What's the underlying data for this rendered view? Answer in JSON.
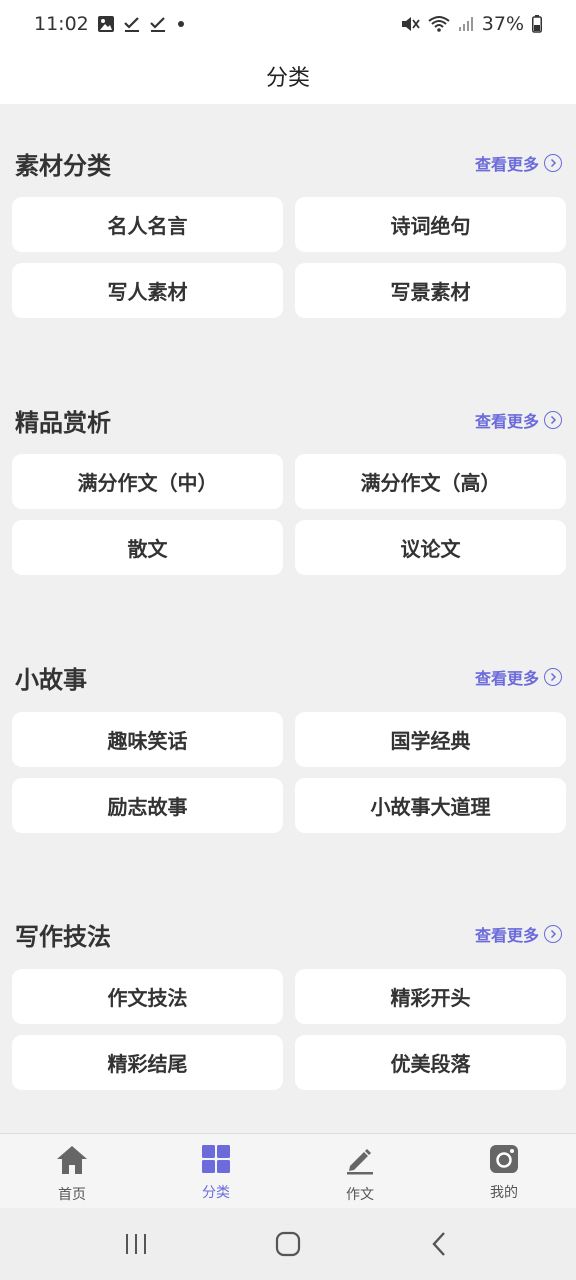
{
  "status_bar": {
    "time": "11:02",
    "battery": "37%",
    "left_icons": [
      "image-icon",
      "check-icon",
      "check-icon",
      "dot-icon"
    ],
    "right_icons": [
      "mute-icon",
      "wifi-icon",
      "signal-icon",
      "battery-icon"
    ]
  },
  "header": {
    "title": "分类"
  },
  "more_label": "查看更多",
  "sections": [
    {
      "title": "素材分类",
      "items": [
        "名人名言",
        "诗词绝句",
        "写人素材",
        "写景素材"
      ]
    },
    {
      "title": "精品赏析",
      "items": [
        "满分作文（中）",
        "满分作文（高）",
        "散文",
        "议论文"
      ]
    },
    {
      "title": "小故事",
      "items": [
        "趣味笑话",
        "国学经典",
        "励志故事",
        "小故事大道理"
      ]
    },
    {
      "title": "写作技法",
      "items": [
        "作文技法",
        "精彩开头",
        "精彩结尾",
        "优美段落"
      ]
    }
  ],
  "tabs": [
    {
      "label": "首页",
      "icon": "home-icon",
      "active": false
    },
    {
      "label": "分类",
      "icon": "grid-icon",
      "active": true
    },
    {
      "label": "作文",
      "icon": "pen-icon",
      "active": false
    },
    {
      "label": "我的",
      "icon": "camera-icon",
      "active": false
    }
  ],
  "colors": {
    "accent": "#6b6bdc",
    "background": "#f0f0f0",
    "tile": "#ffffff"
  }
}
